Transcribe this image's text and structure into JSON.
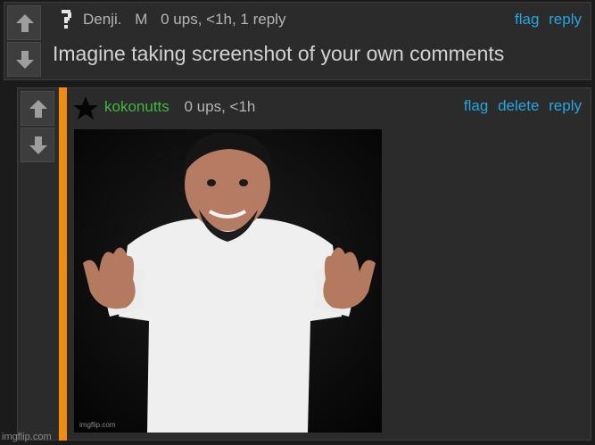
{
  "parent_comment": {
    "username": "Denji.",
    "badge": "M",
    "stats": "0 ups, <1h, 1 reply",
    "links": [
      "flag",
      "reply"
    ],
    "text": "Imagine taking screenshot of your own comments"
  },
  "reply_comment": {
    "username": "kokonutts",
    "stats": "0 ups, <1h",
    "links": [
      "flag",
      "delete",
      "reply"
    ],
    "image_caption": "imgflip.com"
  },
  "watermark": "imgflip.com",
  "colors": {
    "background": "#1b1b1b",
    "panel": "#2b2b2b",
    "link": "#25a6e0",
    "username_green": "#3fb93f",
    "reply_bar": "#f08c12"
  }
}
